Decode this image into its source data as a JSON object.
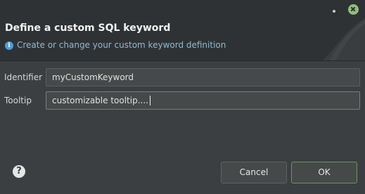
{
  "dialog": {
    "header": {
      "title": "Define a custom SQL keyword",
      "info_icon_glyph": "i",
      "info_icon_name": "info-icon",
      "subtitle": "Create or change your custom keyword definition"
    },
    "titlebar": {
      "minimize_icon": "minimize-dot-icon",
      "close_icon": "close-icon",
      "close_color": "#8fbf7c"
    },
    "fields": {
      "identifier": {
        "label": "Identifier",
        "value": "myCustomKeyword"
      },
      "tooltip": {
        "label": "Tooltip",
        "value": "customizable tooltip...."
      }
    },
    "footer": {
      "help_glyph": "?",
      "help_icon_name": "help-icon",
      "cancel_label": "Cancel",
      "ok_label": "OK"
    }
  },
  "colors": {
    "background": "#3c3f41",
    "header_background": "#2f3234",
    "subtitle": "#8fb9d3",
    "ok_border": "#6a9955"
  }
}
